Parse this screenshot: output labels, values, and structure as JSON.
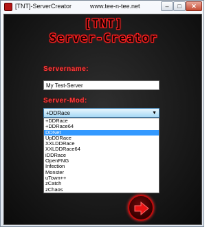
{
  "window": {
    "title": "[TNT]-ServerCreator",
    "url": "www.tee-n-tee.net",
    "minimize": "–",
    "maximize": "□",
    "close": "✕"
  },
  "logo": {
    "line1": "[TNT]",
    "line2": "Server-Creator",
    "color": "#ff2020"
  },
  "form": {
    "servername_label": "Servername:",
    "servername_value": "My Test-Server",
    "servermod_label": "Server-Mod:",
    "servermod_value": "+DDRace",
    "dropdown_arrow": "▼"
  },
  "mods": [
    {
      "label": "+DDRace",
      "selected": false
    },
    {
      "label": "+DDRace64",
      "selected": false
    },
    {
      "label": "DDNet",
      "selected": true
    },
    {
      "label": "UpDDRace",
      "selected": false
    },
    {
      "label": "XXLDDRace",
      "selected": false
    },
    {
      "label": "XXLDDRace64",
      "selected": false
    },
    {
      "label": "iDDRace",
      "selected": false
    },
    {
      "label": "OpenFNG",
      "selected": false
    },
    {
      "label": "Infection",
      "selected": false
    },
    {
      "label": "Monster",
      "selected": false
    },
    {
      "label": "uTown++",
      "selected": false
    },
    {
      "label": "zCatch",
      "selected": false
    },
    {
      "label": "zChaos",
      "selected": false
    }
  ],
  "icons": {
    "app": "tnt-app-icon",
    "next": "arrow-right-icon"
  },
  "colors": {
    "accent_red": "#ff3a3a",
    "selection_blue": "#3399ff",
    "background_dark": "#1b1b1b"
  }
}
